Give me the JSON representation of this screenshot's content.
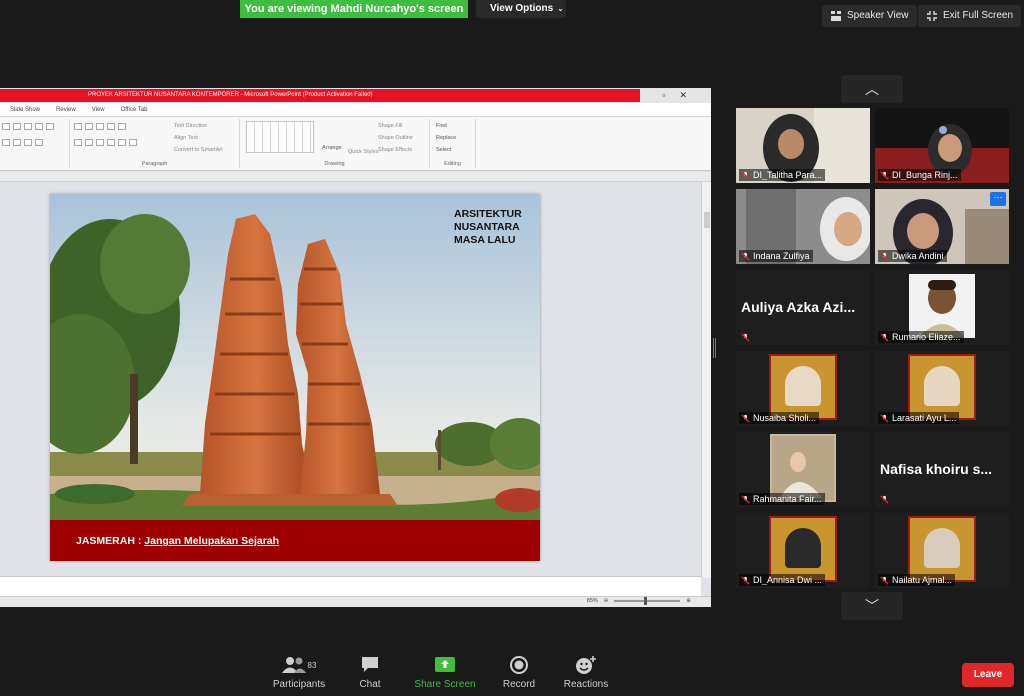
{
  "banner": {
    "viewing_text": "You are viewing Mahdi Nurcahyo's screen",
    "view_options": "View Options"
  },
  "top_buttons": {
    "speaker_view": "Speaker View",
    "exit_full_screen": "Exit Full Screen"
  },
  "powerpoint": {
    "title": "PROYEK ARSITEKTUR NUSANTARA KONTEMPORER  -  Microsoft PowerPoint (Product Activation Failed)",
    "tabs": [
      "Slide Show",
      "Review",
      "View",
      "Office Tab"
    ],
    "ribbon": {
      "paragraph_label": "Paragraph",
      "drawing_label": "Drawing",
      "editing_label": "Editing",
      "text_direction": "Text Direction",
      "align_text": "Align Text",
      "convert_smartart": "Convert to SmartArt",
      "arrange": "Arrange",
      "quick_styles": "Quick Styles",
      "shape_fill": "Shape Fill",
      "shape_outline": "Shape Outline",
      "shape_effects": "Shape Effects",
      "find": "Find",
      "replace": "Replace",
      "select": "Select"
    },
    "zoom_level": "85%"
  },
  "slide": {
    "heading_lines": [
      "ARSITEKTUR",
      "NUSANTARA",
      "MASA LALU"
    ],
    "caption_prefix": "JASMERAH :",
    "caption_text": "Jangan Melupakan Sejarah"
  },
  "participants": [
    {
      "name": "DI_Talitha Para...",
      "type": "video"
    },
    {
      "name": "DI_Bunga Rinj...",
      "type": "video"
    },
    {
      "name": "Indana Zulfiya",
      "type": "video"
    },
    {
      "name": "Dwika Andini",
      "type": "video"
    },
    {
      "name": "Auliya Azka Azi...",
      "type": "text"
    },
    {
      "name": "Rumario Eliaze...",
      "type": "avatar"
    },
    {
      "name": "Nusaiba Sholi...",
      "type": "frame"
    },
    {
      "name": "Larasati Ayu L...",
      "type": "frame"
    },
    {
      "name": "Rahmanita Fair...",
      "type": "painting"
    },
    {
      "name": "Nafisa khoiru s...",
      "type": "text"
    },
    {
      "name": "DI_Annisa Dwi ...",
      "type": "frame"
    },
    {
      "name": "Nailatu Ajmal...",
      "type": "frame"
    }
  ],
  "toolbar": {
    "participants_label": "Participants",
    "participants_count": "83",
    "chat_label": "Chat",
    "share_screen_label": "Share Screen",
    "record_label": "Record",
    "reactions_label": "Reactions",
    "leave_label": "Leave"
  },
  "colors": {
    "share_green": "#3ebd3e",
    "leave_red": "#e02828",
    "slide_band": "#9c0000"
  }
}
